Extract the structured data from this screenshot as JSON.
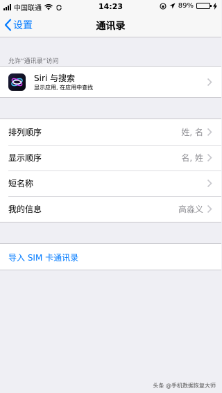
{
  "status": {
    "carrier": "中国联通",
    "time": "14:23",
    "battery": "89%",
    "battery_level": 0.89
  },
  "nav": {
    "back_label": "设置",
    "title": "通讯录"
  },
  "access_section": {
    "header": "允许“通讯录”访问"
  },
  "siri": {
    "title": "Siri 与搜索",
    "subtitle": "显示应用, 在应用中查找"
  },
  "settings": {
    "rows": [
      {
        "label": "排列顺序",
        "value": "姓, 名"
      },
      {
        "label": "显示顺序",
        "value": "名, 姓"
      },
      {
        "label": "短名称",
        "value": ""
      },
      {
        "label": "我的信息",
        "value": "高淼义"
      }
    ]
  },
  "import": {
    "label": "导入 SIM 卡通讯录"
  },
  "watermark": "头条 @手机数据恢复大师",
  "colors": {
    "accent": "#007aff",
    "background": "#efeff4",
    "battery": "#4cd964"
  }
}
